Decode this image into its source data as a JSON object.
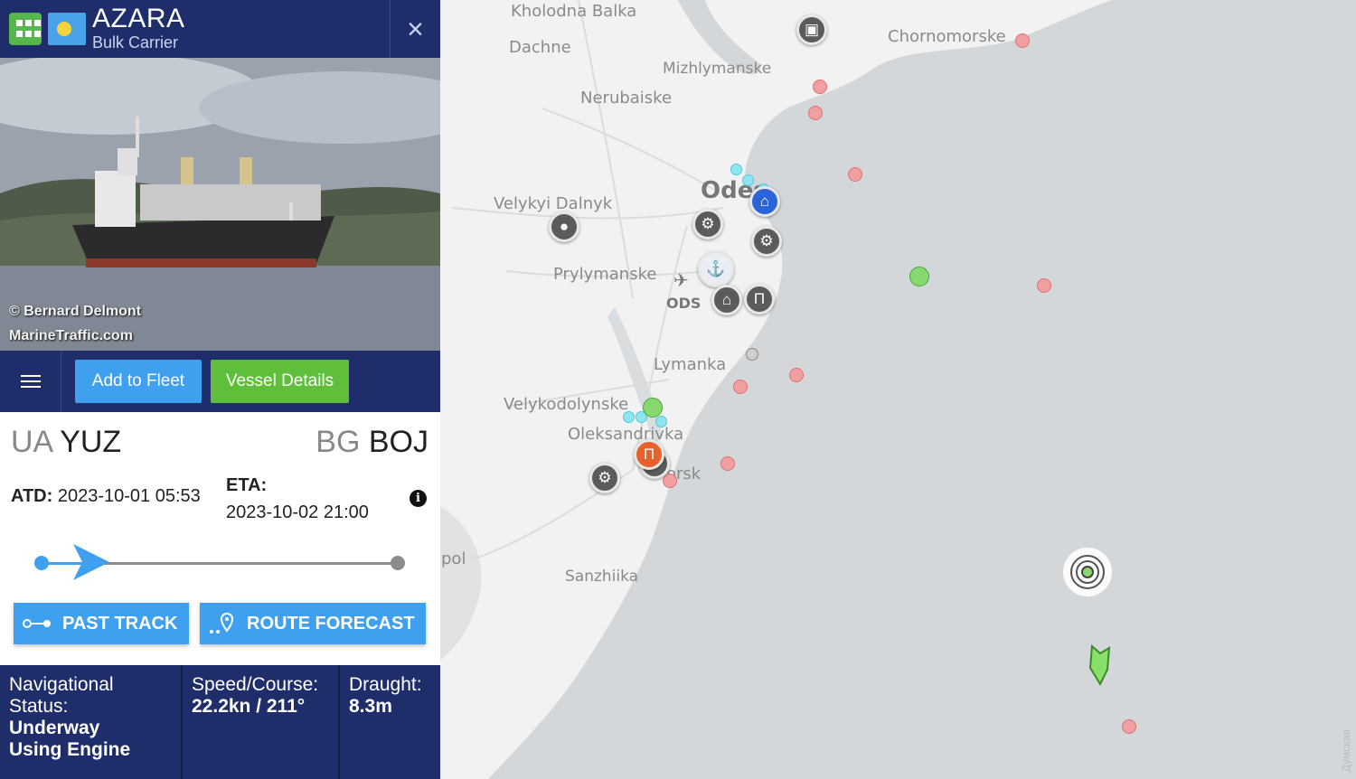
{
  "vessel": {
    "name": "AZARA",
    "type": "Bulk Carrier",
    "close_label": "×",
    "photo_credit_1": "© Bernard Delmont",
    "photo_credit_2": "MarineTraffic.com"
  },
  "actions": {
    "add_to_fleet": "Add to Fleet",
    "vessel_details": "Vessel Details"
  },
  "route": {
    "from_country": "UA",
    "from_port": "YUZ",
    "to_country": "BG",
    "to_port": "BOJ",
    "atd_label": "ATD:",
    "atd_value": "2023-10-01 05:53",
    "eta_label": "ETA:",
    "eta_value": "2023-10-02 21:00",
    "info_icon": "i",
    "progress": 0.14,
    "past_track": "PAST TRACK",
    "route_forecast": "ROUTE FORECAST"
  },
  "stats": {
    "nav_label_1": "Navigational",
    "nav_label_2": "Status:",
    "nav_value_1": "Underway",
    "nav_value_2": "Using Engine",
    "speed_label": "Speed/Course:",
    "speed_value": "22.2kn / 211°",
    "draught_label": "Draught:",
    "draught_value": "8.3m"
  },
  "map": {
    "places": {
      "kholodna_balka": "Kholodna Balka",
      "dachne": "Dachne",
      "mizhlymanske": "Mizhlymanske",
      "chornomorske": "Chornomorske",
      "nerubaiske": "Nerubaiske",
      "velykyi_dalnyk": "Velykyi Dalnyk",
      "odesa": "Odes",
      "prylymanske": "Prylymanske",
      "ods": "ODS",
      "lymanka": "Lymanka",
      "velykodolynske": "Velykodolynske",
      "oleksandrivka": "Oleksandrivka",
      "chornomorsk": "orsk",
      "sanzhiika": "Sanzhiika",
      "pol": "pol"
    },
    "watermark": "Думская"
  },
  "colors": {
    "navy": "#1f2e6a",
    "blue_button": "#3fa0f0",
    "green_button": "#5fbe3a",
    "sea": "#d3d7da",
    "land": "#f2f2f2"
  }
}
